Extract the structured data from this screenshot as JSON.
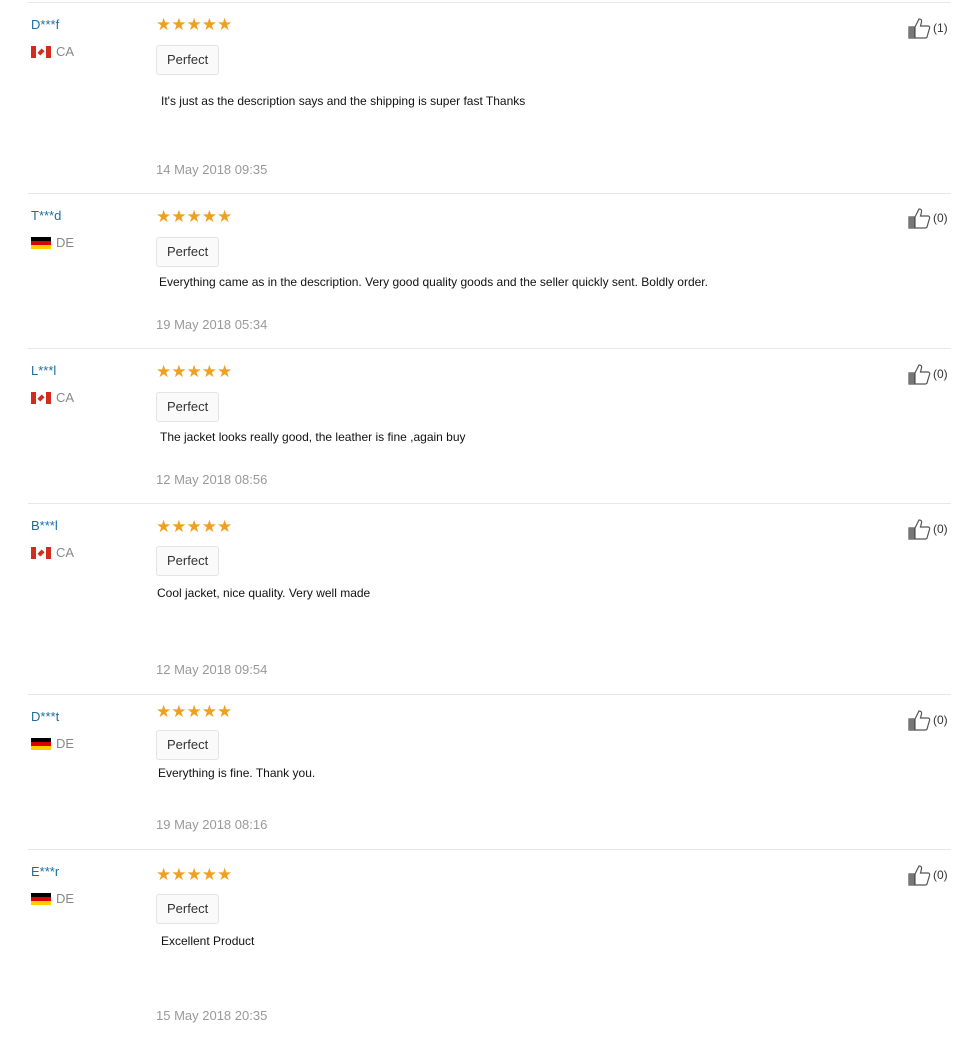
{
  "reviews": [
    {
      "user": "D***f",
      "country": "CA",
      "flag": "ca",
      "stars": 5,
      "tag": "Perfect",
      "text": "It's just as the description says and the shipping is super fast Thanks",
      "date": "14 May 2018 09:35",
      "likes": "(1)"
    },
    {
      "user": "T***d",
      "country": "DE",
      "flag": "de",
      "stars": 5,
      "tag": "Perfect",
      "text": "Everything came as in the description. Very good quality goods and the seller quickly sent. Boldly order.",
      "date": "19 May 2018 05:34",
      "likes": "(0)"
    },
    {
      "user": "L***l",
      "country": "CA",
      "flag": "ca",
      "stars": 5,
      "tag": "Perfect",
      "text": "The jacket looks really good, the leather is fine ,again buy",
      "date": "12 May 2018 08:56",
      "likes": "(0)"
    },
    {
      "user": "B***l",
      "country": "CA",
      "flag": "ca",
      "stars": 5,
      "tag": "Perfect",
      "text": "Cool jacket, nice quality. Very well made",
      "date": "12 May 2018 09:54",
      "likes": "(0)"
    },
    {
      "user": "D***t",
      "country": "DE",
      "flag": "de",
      "stars": 5,
      "tag": "Perfect",
      "text": "Everything is fine. Thank you.",
      "date": "19 May 2018 08:16",
      "likes": "(0)"
    },
    {
      "user": "E***r",
      "country": "DE",
      "flag": "de",
      "stars": 5,
      "tag": "Perfect",
      "text": "Excellent Product",
      "date": "15 May 2018 20:35",
      "likes": "(0)"
    }
  ],
  "colors": {
    "star": "#f0a020",
    "username": "#1a6fa0",
    "date": "#999999"
  },
  "icons": {
    "like": "thumbs-up-icon",
    "star": "star-icon"
  }
}
